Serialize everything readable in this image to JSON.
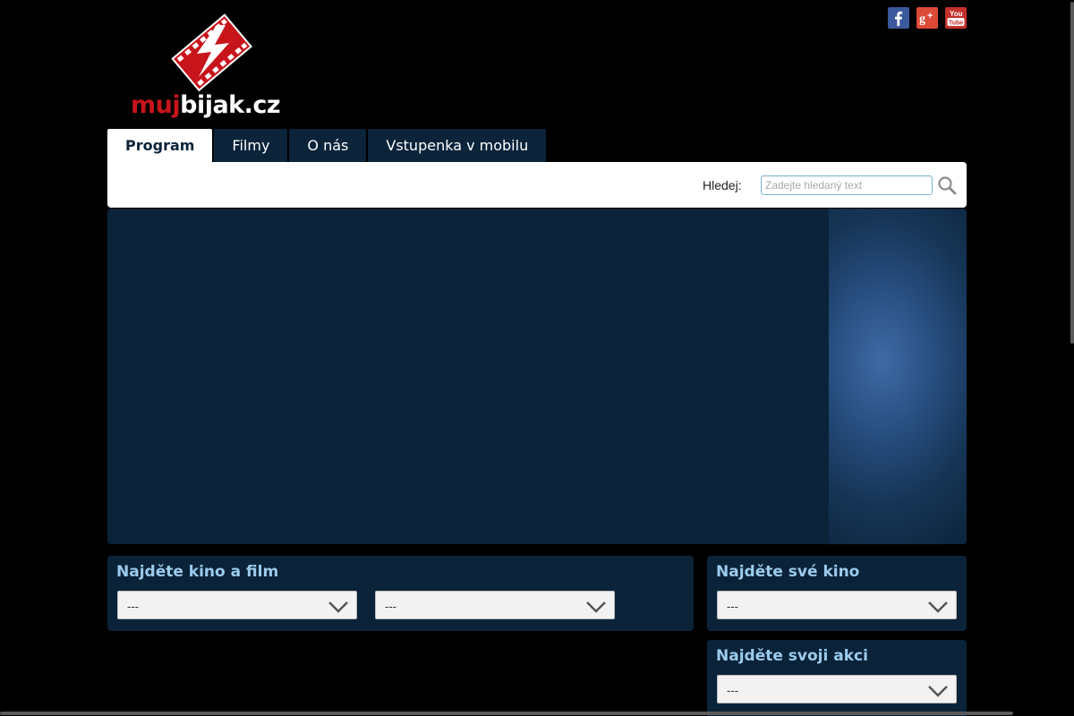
{
  "site": {
    "logo_part1": "muj",
    "logo_part2": "bijak.cz"
  },
  "social": [
    {
      "name": "facebook-icon",
      "color": "#3a589b"
    },
    {
      "name": "google-plus-icon",
      "color": "#dc4a38"
    },
    {
      "name": "youtube-icon",
      "color": "#c4302b"
    }
  ],
  "nav": {
    "tabs": [
      {
        "label": "Program",
        "active": true
      },
      {
        "label": "Filmy",
        "active": false
      },
      {
        "label": "O nás",
        "active": false
      },
      {
        "label": "Vstupenka v mobilu",
        "active": false
      }
    ]
  },
  "search": {
    "label": "Hledej:",
    "placeholder": "Zadejte hledaný text",
    "value": ""
  },
  "panels": {
    "find_cinema_film": {
      "title": "Najděte kino a film",
      "select1": "---",
      "select2": "---"
    },
    "find_your_cinema": {
      "title": "Najděte své kino",
      "select": "---"
    },
    "find_your_event": {
      "title": "Najděte svoji akci",
      "select": "---"
    }
  },
  "colors": {
    "navy": "#0b2339",
    "panel_title": "#9ccbed",
    "brand_red": "#c8141b"
  }
}
